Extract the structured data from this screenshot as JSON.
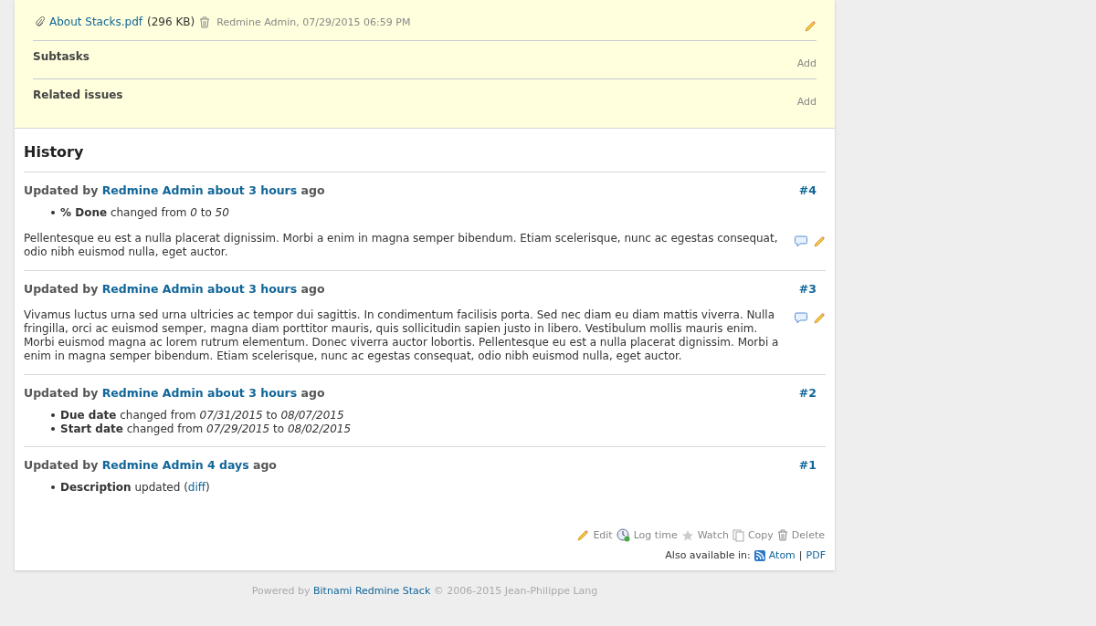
{
  "attachment": {
    "file": "About Stacks.pdf",
    "size": "(296 KB)",
    "meta": "Redmine Admin, 07/29/2015 06:59 PM"
  },
  "sections": [
    {
      "title": "Subtasks",
      "action": "Add"
    },
    {
      "title": "Related issues",
      "action": "Add"
    }
  ],
  "history": {
    "title": "History",
    "journals": [
      {
        "prefix": "Updated by",
        "author": "Redmine Admin",
        "when": "about 3 hours",
        "suffix": "ago",
        "number": "#4",
        "details": [
          {
            "text": "**% Done** changed from *0* to *50*"
          }
        ],
        "note": "Pellentesque eu est a nulla placerat dignissim. Morbi a enim in magna semper bibendum. Etiam scelerisque, nunc ac egestas consequat, odio nibh euismod nulla, eget auctor."
      },
      {
        "prefix": "Updated by",
        "author": "Redmine Admin",
        "when": "about 3 hours",
        "suffix": "ago",
        "number": "#3",
        "note": "Vivamus luctus urna sed urna ultricies ac tempor dui sagittis. In condimentum facilisis porta. Sed nec diam eu diam mattis viverra. Nulla fringilla, orci ac euismod semper, magna diam porttitor mauris, quis sollicitudin sapien justo in libero. Vestibulum mollis mauris enim. Morbi euismod magna ac lorem rutrum elementum. Donec viverra auctor lobortis. Pellentesque eu est a nulla placerat dignissim. Morbi a enim in magna semper bibendum. Etiam scelerisque, nunc ac egestas consequat, odio nibh euismod nulla, eget auctor."
      },
      {
        "prefix": "Updated by",
        "author": "Redmine Admin",
        "when": "about 3 hours",
        "suffix": "ago",
        "number": "#2",
        "details": [
          {
            "text": "**Due date** changed from *07/31/2015* to *08/07/2015*"
          },
          {
            "text": "**Start date** changed from *07/29/2015* to *08/02/2015*"
          }
        ]
      },
      {
        "prefix": "Updated by",
        "author": "Redmine Admin",
        "when": "4 days",
        "suffix": "ago",
        "number": "#1",
        "details": [
          {
            "text": "**Description** updated (",
            "link": "diff",
            "tail": ")"
          }
        ]
      }
    ]
  },
  "actions": [
    {
      "kind": "edit",
      "label": "Edit"
    },
    {
      "kind": "log",
      "label": "Log time"
    },
    {
      "kind": "watch",
      "label": "Watch"
    },
    {
      "kind": "copy",
      "label": "Copy"
    },
    {
      "kind": "delete",
      "label": "Delete"
    }
  ],
  "formats": {
    "label": "Also available in:",
    "links": [
      "Atom",
      "PDF"
    ],
    "separator": "|"
  },
  "footer": {
    "prefix": "Powered by",
    "link": "Bitnami Redmine Stack",
    "suffix": "© 2006-2015 Jean-Philippe Lang"
  }
}
